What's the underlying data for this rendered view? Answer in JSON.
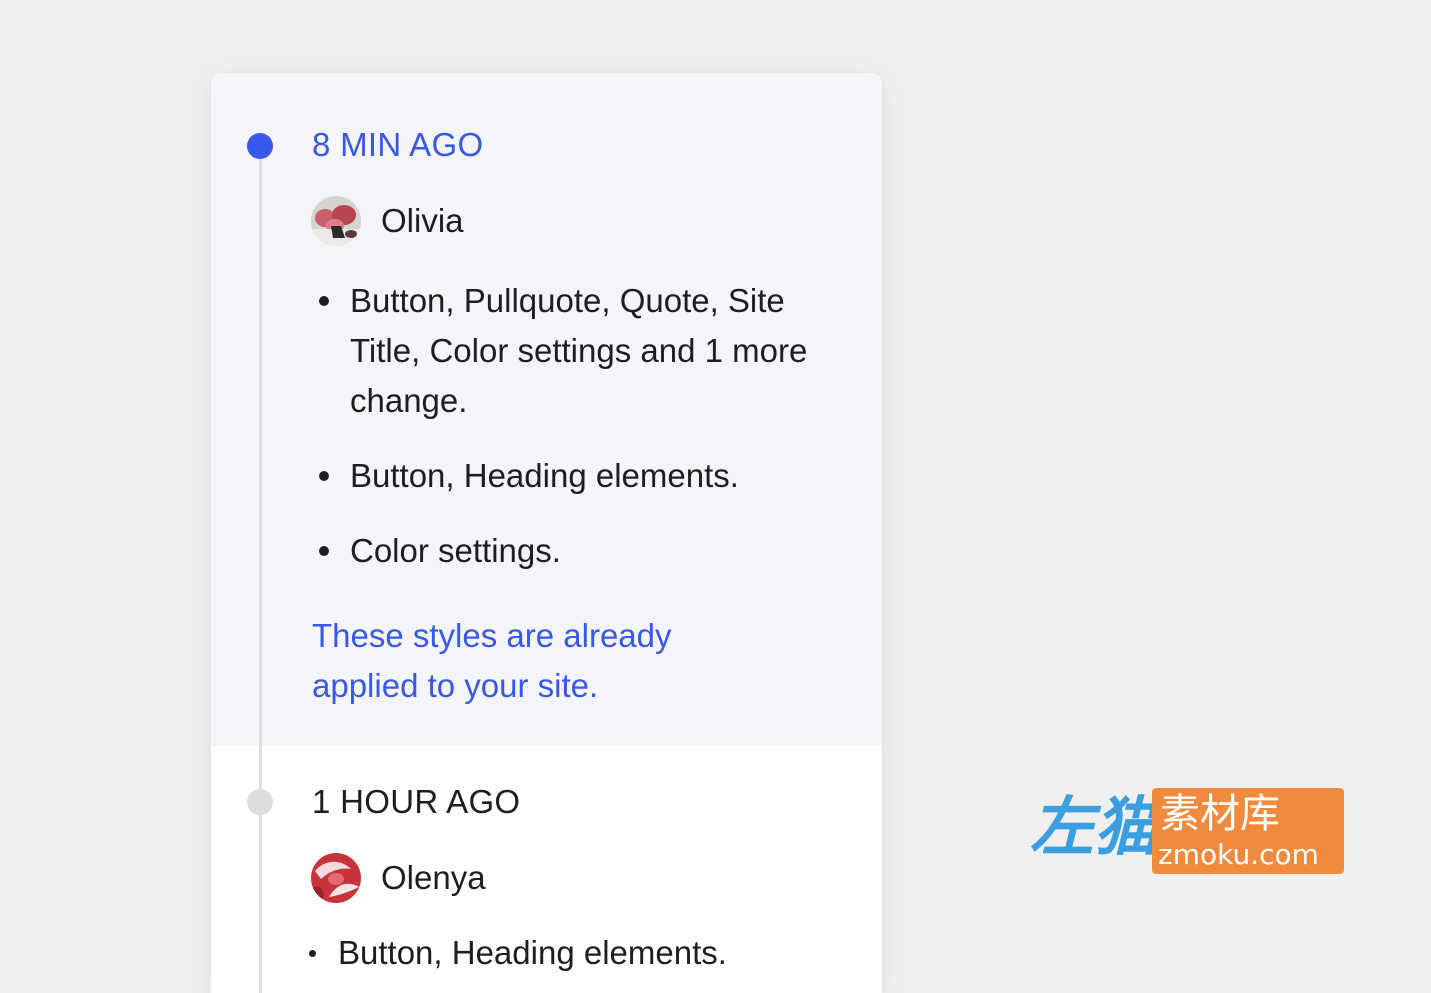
{
  "colors": {
    "accent": "#3858e9",
    "page_background": "#efefef",
    "active_entry_background": "#f4f5fb",
    "inactive_dot": "#dcdcdc",
    "text": "#1e1e1e",
    "watermark_blue": "#3b9ee0",
    "watermark_orange": "#f08a3c"
  },
  "revisions": [
    {
      "time": "8 MIN AGO",
      "author": "Olivia",
      "avatar_icon": "avatar-photo-olivia",
      "changes": [
        "Button, Pullquote, Quote, Site Title, Color settings and 1 more change.",
        "Button, Heading elements.",
        "Color settings."
      ],
      "note": "These styles are already applied to your site."
    },
    {
      "time": "1 HOUR AGO",
      "author": "Olenya",
      "avatar_icon": "avatar-photo-olenya",
      "changes": [
        "Button, Heading elements."
      ]
    }
  ],
  "watermark": {
    "left_text": "左猫",
    "box_top_text": "素材库",
    "box_bottom_text": "zmoku.com"
  }
}
